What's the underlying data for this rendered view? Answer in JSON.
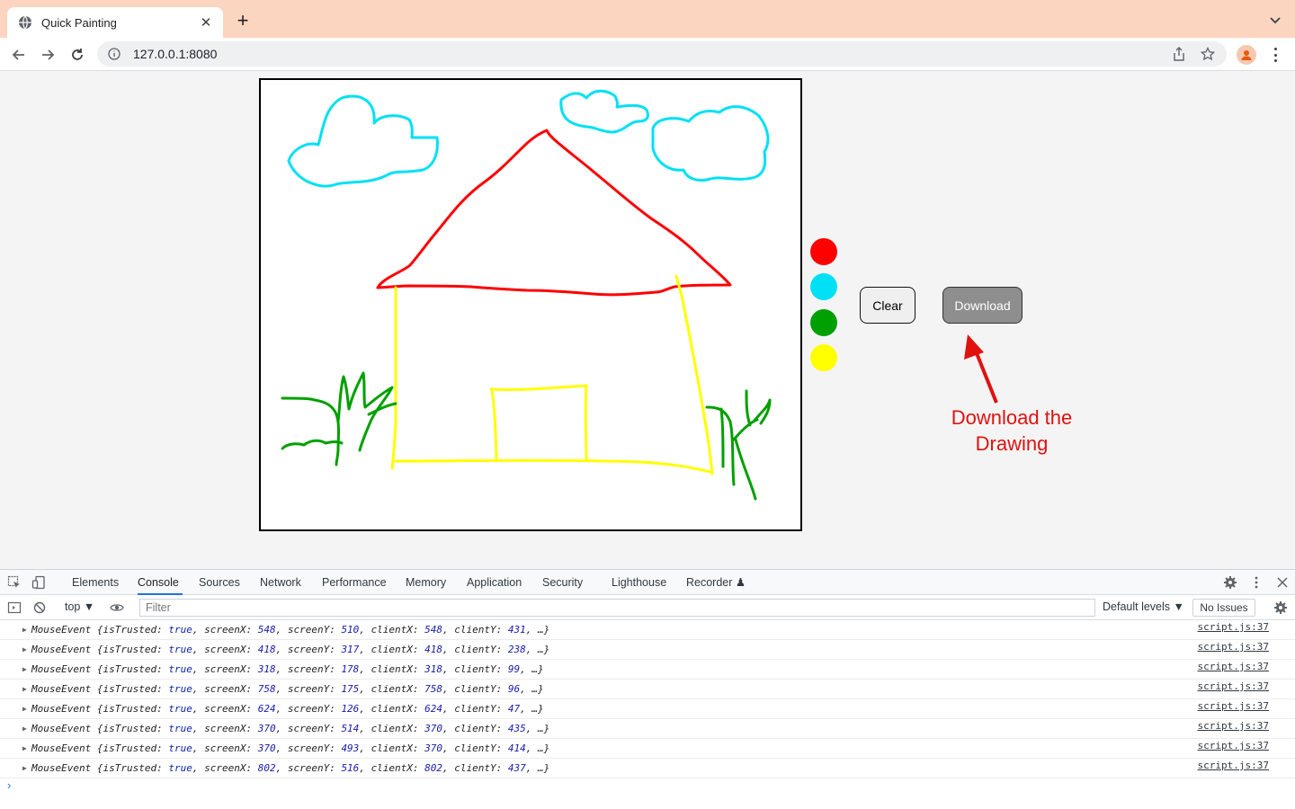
{
  "browser": {
    "tab_title": "Quick Painting",
    "url": "127.0.0.1:8080",
    "new_tab_symbol": "+",
    "tab_close_symbol": "✕",
    "icons": [
      "globe-icon",
      "back-icon",
      "forward-icon",
      "reload-icon",
      "info-icon",
      "share-icon",
      "star-icon",
      "profile-icon",
      "menu-icon"
    ]
  },
  "app": {
    "palette": [
      {
        "name": "red",
        "color": "#ff0000"
      },
      {
        "name": "cyan",
        "color": "#00e0f5"
      },
      {
        "name": "green",
        "color": "#00a000"
      },
      {
        "name": "yellow",
        "color": "#ffff00"
      }
    ],
    "clear_label": "Clear",
    "download_label": "Download",
    "annotation_line1": "Download the",
    "annotation_line2": "Drawing",
    "annotation_color": "#e0120f"
  },
  "devtools": {
    "tabs": [
      "Elements",
      "Console",
      "Sources",
      "Network",
      "Performance",
      "Memory",
      "Application",
      "Security",
      "Lighthouse",
      "Recorder ♟"
    ],
    "active_tab": "Console",
    "context": "top ▼",
    "filter_placeholder": "Filter",
    "levels": "Default levels ▼",
    "issues": "No Issues",
    "logs": [
      {
        "screenX": "548",
        "screenY": "510",
        "clientX": "548",
        "clientY": "431",
        "source": "script.js:37"
      },
      {
        "screenX": "418",
        "screenY": "317",
        "clientX": "418",
        "clientY": "238",
        "source": "script.js:37"
      },
      {
        "screenX": "318",
        "screenY": "178",
        "clientX": "318",
        "clientY": "99",
        "source": "script.js:37"
      },
      {
        "screenX": "758",
        "screenY": "175",
        "clientX": "758",
        "clientY": "96",
        "source": "script.js:37"
      },
      {
        "screenX": "624",
        "screenY": "126",
        "clientX": "624",
        "clientY": "47",
        "source": "script.js:37"
      },
      {
        "screenX": "370",
        "screenY": "514",
        "clientX": "370",
        "clientY": "435",
        "source": "script.js:37"
      },
      {
        "screenX": "370",
        "screenY": "493",
        "clientX": "370",
        "clientY": "414",
        "source": "script.js:37"
      },
      {
        "screenX": "802",
        "screenY": "516",
        "clientX": "802",
        "clientY": "437",
        "source": "script.js:37"
      }
    ]
  }
}
